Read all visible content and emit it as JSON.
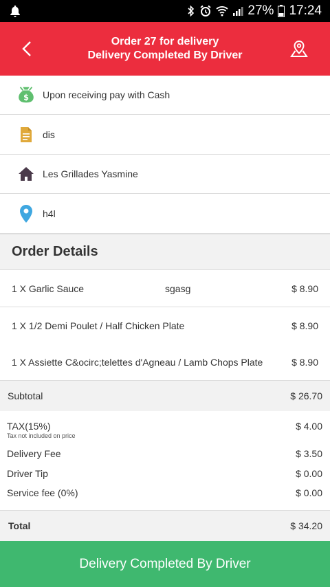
{
  "status_bar": {
    "battery": "27%",
    "time": "17:24"
  },
  "header": {
    "title_line1": "Order 27 for delivery",
    "title_line2": "Delivery Completed By Driver"
  },
  "info": [
    {
      "icon": "money-bag-icon",
      "text": "Upon receiving pay with Cash"
    },
    {
      "icon": "document-icon",
      "text": "dis"
    },
    {
      "icon": "home-icon",
      "text": "Les Grillades Yasmine"
    },
    {
      "icon": "location-pin-icon",
      "text": "h4l"
    }
  ],
  "order_details": {
    "title": "Order Details",
    "items": [
      {
        "name": "1 X Garlic Sauce",
        "note": "sgasg",
        "price": "$ 8.90"
      },
      {
        "name": "1 X 1/2 Demi Poulet / Half Chicken Plate",
        "note": "",
        "price": "$ 8.90"
      },
      {
        "name": "1 X Assiette C&ocirc;telettes d'Agneau / Lamb Chops Plate",
        "note": "",
        "price": "$ 8.90"
      }
    ]
  },
  "summary": {
    "subtotal_label": "Subtotal",
    "subtotal_value": "$ 26.70",
    "tax_label": "TAX(15%)",
    "tax_note": "Tax not included on price",
    "tax_value": "$ 4.00",
    "delivery_label": "Delivery Fee",
    "delivery_value": "$ 3.50",
    "tip_label": "Driver Tip",
    "tip_value": "$ 0.00",
    "service_label": "Service fee (0%)",
    "service_value": "$ 0.00",
    "total_label": "Total",
    "total_value": "$ 34.20"
  },
  "bottom_button": {
    "label": "Delivery Completed By Driver"
  },
  "colors": {
    "header": "#ec2d3e",
    "button": "#3fb86f",
    "money": "#5fbf6f",
    "document": "#e0a93b",
    "home": "#4a3a4a",
    "pin": "#3fa7e0"
  }
}
